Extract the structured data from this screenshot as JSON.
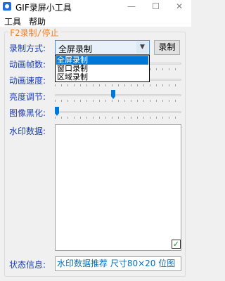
{
  "window": {
    "title": "GIF录屏小工具",
    "minimize_glyph": "—",
    "close_glyph": "✕"
  },
  "menu": {
    "tools": "工具",
    "help": "帮助"
  },
  "group": {
    "legend": "F2录制/停止"
  },
  "labels": {
    "record_mode": "录制方式:",
    "fps": "动画帧数:",
    "speed": "动画速度:",
    "brightness": "亮度调节:",
    "blackening": "图像黑化:",
    "watermark": "水印数据:",
    "status": "状态信息:"
  },
  "record_mode": {
    "value": "全屏录制",
    "options": [
      "全屏录制",
      "窗口录制",
      "区域录制"
    ],
    "selected_index": 0
  },
  "record_button": "录制",
  "sliders": {
    "brightness_fraction": 0.46,
    "blackening_fraction": 0.0
  },
  "watermark_checkbox": {
    "checked": true,
    "glyph": "✓"
  },
  "status": {
    "text": "水印数据推荐 尺寸80×20 位图"
  },
  "colors": {
    "label_blue": "#1a3cb0",
    "legend_orange": "#f08020",
    "accent": "#0078d7",
    "status_text": "#0070c0"
  },
  "icons": {
    "app": "gif-app-icon",
    "dropdown": "chevron-down-icon"
  }
}
